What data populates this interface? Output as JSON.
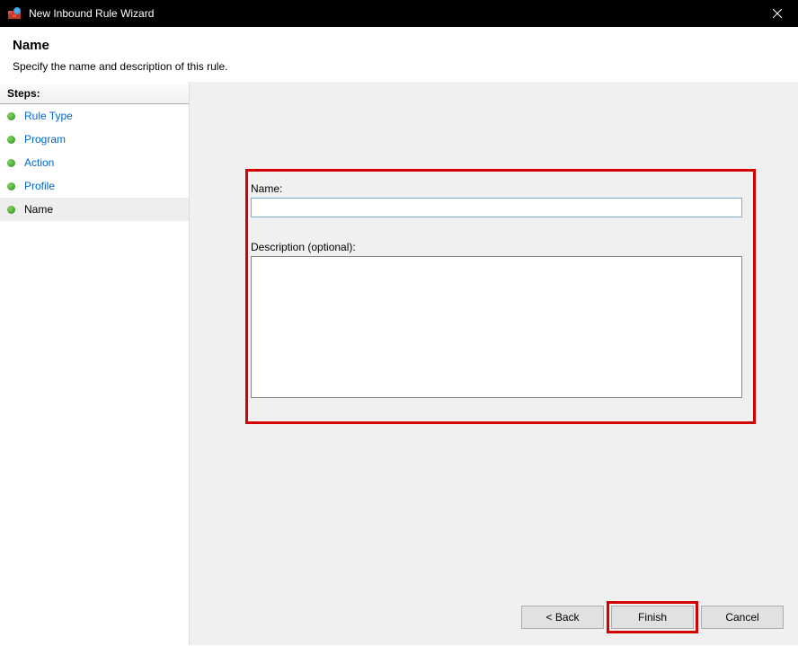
{
  "titlebar": {
    "title": "New Inbound Rule Wizard"
  },
  "header": {
    "title": "Name",
    "subtitle": "Specify the name and description of this rule."
  },
  "sidebar": {
    "header": "Steps:",
    "items": [
      {
        "label": "Rule Type",
        "active": false
      },
      {
        "label": "Program",
        "active": false
      },
      {
        "label": "Action",
        "active": false
      },
      {
        "label": "Profile",
        "active": false
      },
      {
        "label": "Name",
        "active": true
      }
    ]
  },
  "form": {
    "name_label": "Name:",
    "name_value": "",
    "desc_label": "Description (optional):",
    "desc_value": ""
  },
  "buttons": {
    "back": "< Back",
    "finish": "Finish",
    "cancel": "Cancel"
  }
}
